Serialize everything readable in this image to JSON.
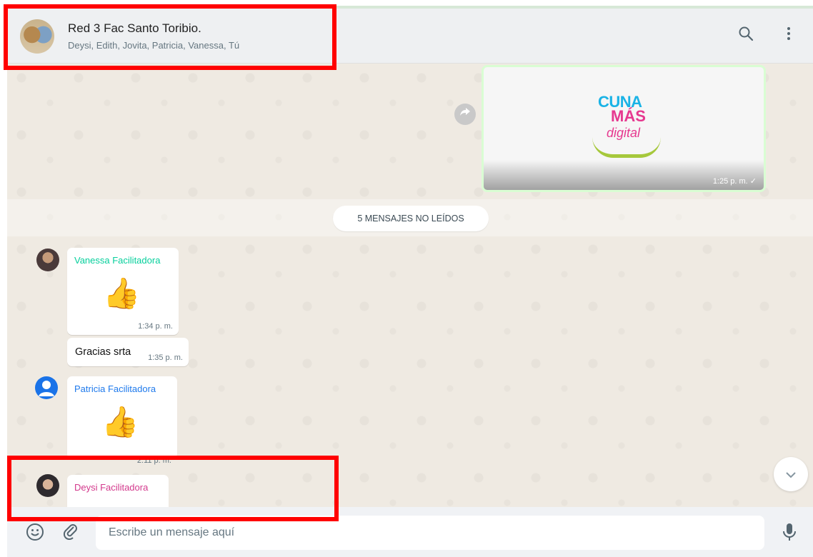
{
  "header": {
    "title": "Red 3 Fac Santo Toribio.",
    "participants": "Deysi, Edith, Jovita, Patricia, Vanessa, Tú"
  },
  "media": {
    "logo_line1": "CUNA",
    "logo_line2": "MÁS",
    "logo_line3": "digital",
    "time": "1:25 p. m. ✓"
  },
  "unread_banner": "5 MENSAJES NO LEÍDOS",
  "messages": [
    {
      "sender": "Vanessa Facilitadora",
      "sender_color": "#06cf9c",
      "emoji": "👍",
      "time": "1:34 p. m."
    },
    {
      "text": "Gracias srta",
      "time": "1:35 p. m."
    },
    {
      "sender": "Patricia Facilitadora",
      "sender_color": "#1f7aec",
      "emoji": "👍",
      "time": "2:11 p. m."
    },
    {
      "sender": "Deysi Facilitadora",
      "sender_color": "#d3398c"
    }
  ],
  "footer": {
    "placeholder": "Escribe un mensaje aquí"
  },
  "icons": {
    "search": "search-icon",
    "menu": "menu-dots-icon",
    "emoji": "emoji-icon",
    "attach": "attach-icon",
    "mic": "mic-icon",
    "forward": "forward-icon",
    "scroll_down": "chevron-down-icon"
  },
  "colors": {
    "highlight": "#ff0000",
    "sent_bubble_border": "#d9fdd3"
  }
}
